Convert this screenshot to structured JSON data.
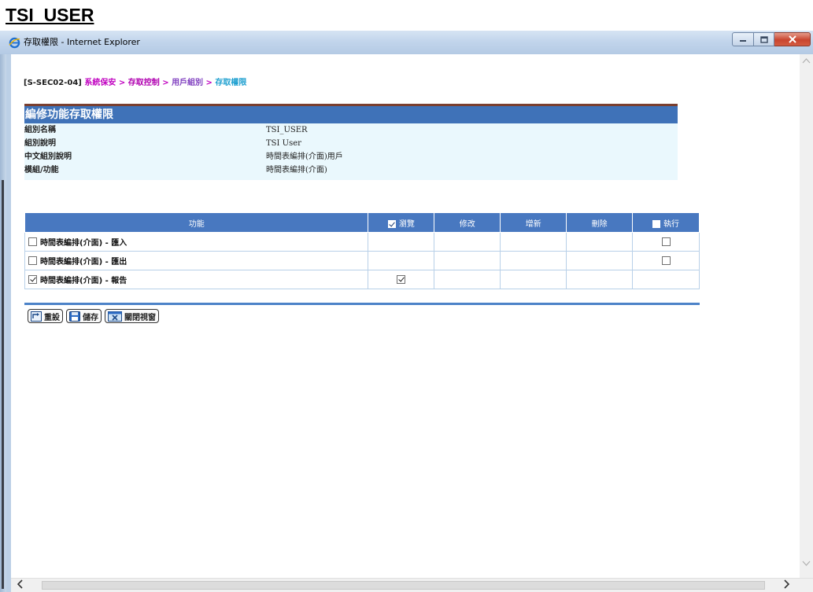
{
  "caption": "TSI_USER",
  "window": {
    "title": "存取權限 - Internet Explorer"
  },
  "breadcrumb": {
    "code": "[S-SEC02-04]",
    "items": [
      "系統保安",
      "存取控制",
      "用戶組別",
      "存取權限"
    ],
    "separator": ">"
  },
  "form": {
    "title": "編修功能存取權限",
    "rows": [
      {
        "label": "組別名稱",
        "value": "TSI_USER"
      },
      {
        "label": "組別說明",
        "value": "TSI User"
      },
      {
        "label": "中文組別說明",
        "value": "時間表編排(介面)用戶"
      },
      {
        "label": "模組/功能",
        "value": "時間表編排(介面)"
      }
    ]
  },
  "table": {
    "headers": {
      "function": "功能",
      "browse": "瀏覽",
      "modify": "修改",
      "add": "增新",
      "delete": "刪除",
      "execute": "執行"
    },
    "header_checks": {
      "browse": true,
      "execute": false
    },
    "rows": [
      {
        "name": "時間表編排(介面) - 匯入",
        "row_checked": false,
        "browse": null,
        "execute": false
      },
      {
        "name": "時間表編排(介面) - 匯出",
        "row_checked": false,
        "browse": null,
        "execute": false
      },
      {
        "name": "時間表編排(介面) - 報告",
        "row_checked": true,
        "browse": true,
        "execute": null
      }
    ]
  },
  "buttons": {
    "reset": "重設",
    "save": "儲存",
    "close": "關閉視窗"
  },
  "colors": {
    "header_blue": "#3f72b8",
    "table_header_blue": "#4878c0",
    "info_bg": "#eaf8fd",
    "breadcrumb_magenta": "#c000c0",
    "breadcrumb_cyan": "#20a0d0"
  }
}
